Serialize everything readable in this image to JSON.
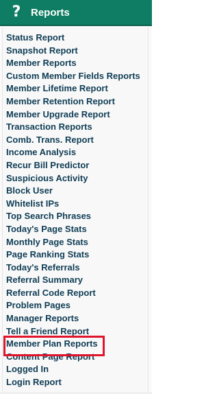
{
  "header": {
    "icon": "help-question-icon",
    "title": "Reports",
    "background_color": "#0f7d63"
  },
  "menu": {
    "items": [
      "Status Report",
      "Snapshot Report",
      "Member Reports",
      "Custom Member Fields Reports",
      "Member Lifetime Report",
      "Member Retention Report",
      "Member Upgrade Report",
      "Transaction Reports",
      "Comb. Trans. Report",
      "Income Analysis",
      "Recur Bill Predictor",
      "Suspicious Activity",
      "Block User",
      "Whitelist IPs",
      "Top Search Phrases",
      "Today's Page Stats",
      "Monthly Page Stats",
      "Page Ranking Stats",
      "Today's Referrals",
      "Referral Summary",
      "Referral Code Report",
      "Problem Pages",
      "Manager Reports",
      "Tell a Friend Report",
      "Member Plan Reports",
      "Content Page Report",
      "Logged In",
      "Login Report"
    ],
    "highlighted_item": "Member Plan Reports",
    "highlight_color": "#e0142a",
    "link_color": "#0f3d55"
  }
}
